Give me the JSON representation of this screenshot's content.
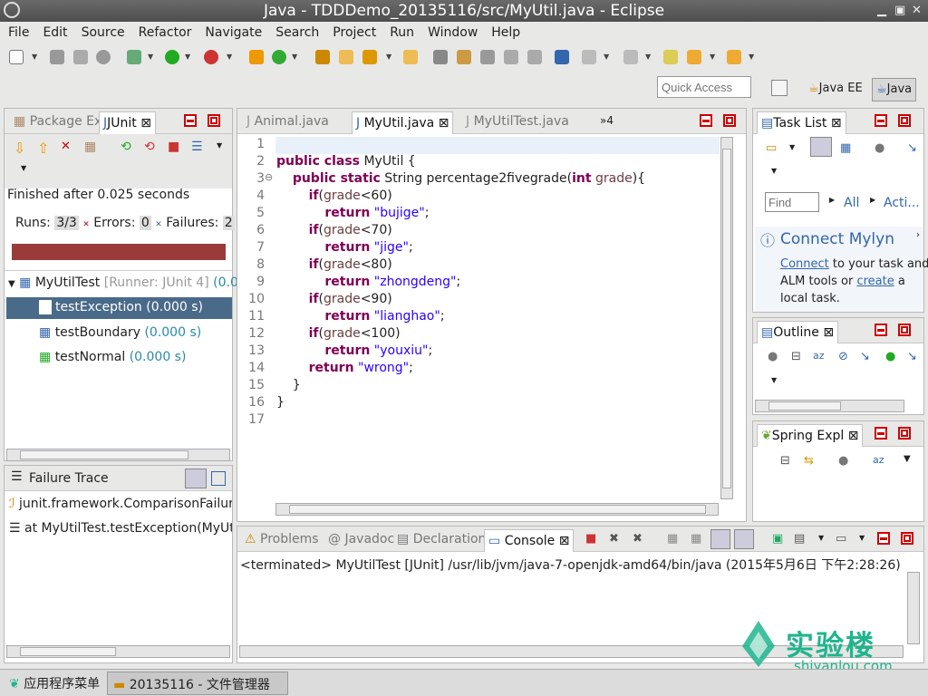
{
  "window": {
    "title": "Java - TDDDemo_20135116/src/MyUtil.java - Eclipse"
  },
  "menu": [
    "File",
    "Edit",
    "Source",
    "Refactor",
    "Navigate",
    "Search",
    "Project",
    "Run",
    "Window",
    "Help"
  ],
  "toolbar": {
    "quick_access_placeholder": "Quick Access",
    "perspectives": [
      "Java EE",
      "Java"
    ]
  },
  "left_panel": {
    "tabs": [
      "Package Ex",
      "JUnit"
    ],
    "status": "Finished after 0.025 seconds",
    "runs_label": "Runs:",
    "runs_value": "3/3",
    "errors_label": "Errors:",
    "errors_value": "0",
    "failures_label": "Failures:",
    "failures_value": "2",
    "progress_color": "#9b3a3a",
    "suite": {
      "name": "MyUtilTest",
      "runner": "[Runner: JUnit 4]",
      "time": "(0.00"
    },
    "tests": [
      {
        "name": "testException",
        "time": "(0.000 s)"
      },
      {
        "name": "testBoundary",
        "time": "(0.000 s)"
      },
      {
        "name": "testNormal",
        "time": "(0.000 s)"
      }
    ],
    "failure_trace_label": "Failure Trace",
    "trace_lines": [
      "junit.framework.ComparisonFailure",
      "at MyUtilTest.testException(MyUtil"
    ]
  },
  "editor": {
    "tabs": [
      "Animal.java",
      "MyUtil.java",
      "MyUtilTest.java"
    ],
    "overflow": "»4",
    "line_numbers": [
      "1",
      "2",
      "3",
      "4",
      "5",
      "6",
      "7",
      "8",
      "9",
      "10",
      "11",
      "12",
      "13",
      "14",
      "15",
      "16",
      "17"
    ]
  },
  "console": {
    "tabs": [
      "Problems",
      "Javadoc",
      "Declaration",
      "Console"
    ],
    "text": "<terminated> MyUtilTest [JUnit] /usr/lib/jvm/java-7-openjdk-amd64/bin/java (2015年5月6日 下午2:28:26)"
  },
  "right_panel": {
    "task_list": "Task List",
    "find_placeholder": "Find",
    "all": "All",
    "acti": "Acti...",
    "connect_title": "Connect Mylyn",
    "connect_link": "Connect",
    "connect_text1": " to your task and",
    "connect_text2": "ALM tools or ",
    "create_link": "create",
    "connect_text3": " a",
    "connect_text4": "local task.",
    "outline": "Outline",
    "spring": "Spring Expl"
  },
  "taskbar": {
    "start": "应用程序菜单",
    "window": "20135116 - 文件管理器"
  },
  "watermark": {
    "brand": "实验楼",
    "url": "shiyanlou.com"
  }
}
